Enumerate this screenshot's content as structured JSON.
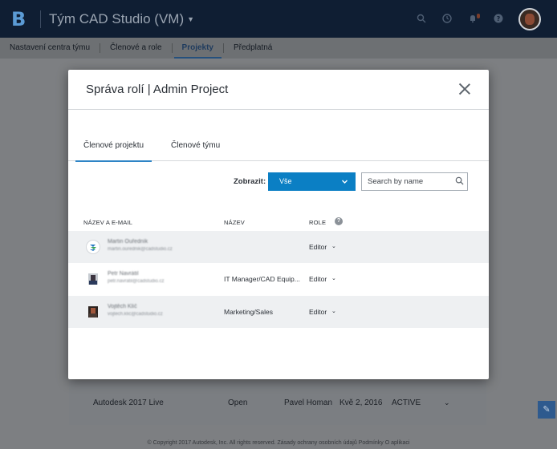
{
  "app": {
    "title": "Tým CAD Studio (VM)"
  },
  "nav": {
    "items": [
      {
        "label": "Nastavení centra týmu",
        "active": false
      },
      {
        "label": "Členové a role",
        "active": false
      },
      {
        "label": "Projekty",
        "active": true
      },
      {
        "label": "Předplatná",
        "active": false
      }
    ]
  },
  "background_row": {
    "name": "Autodesk 2017 Live",
    "status": "Open",
    "owner": "Pavel Homan",
    "date": "Kvě 2, 2016",
    "state": "ACTIVE"
  },
  "footer": {
    "text": "© Copyright 2017 Autodesk, Inc. All rights reserved.   Zásady ochrany osobních údajů   Podmínky   O aplikaci"
  },
  "modal": {
    "title": "Správa rolí | Admin Project",
    "tabs": [
      {
        "label": "Členové projektu",
        "active": true
      },
      {
        "label": "Členové týmu",
        "active": false
      }
    ],
    "filter_label": "Zobrazit:",
    "filter_value": "Vše",
    "search_placeholder": "Search by name",
    "columns": {
      "name_email": "NÁZEV A E-MAIL",
      "title": "NÁZEV",
      "role": "ROLE",
      "help": "?"
    },
    "members": [
      {
        "name": "Martin Ouředník",
        "email": "martin.ourednik@cadstudio.cz",
        "title": "",
        "role": "Editor"
      },
      {
        "name": "Petr Navrátil",
        "email": "petr.navratil@cadstudio.cz",
        "title": "IT Manager/CAD Equip...",
        "role": "Editor"
      },
      {
        "name": "Vojtěch Klíč",
        "email": "vojtech.klic@cadstudio.cz",
        "title": "Marketing/Sales",
        "role": "Editor"
      }
    ]
  },
  "colors": {
    "accent": "#0b7fc4",
    "topbar": "#0f1e33",
    "tab_underline": "#2e84c6"
  }
}
